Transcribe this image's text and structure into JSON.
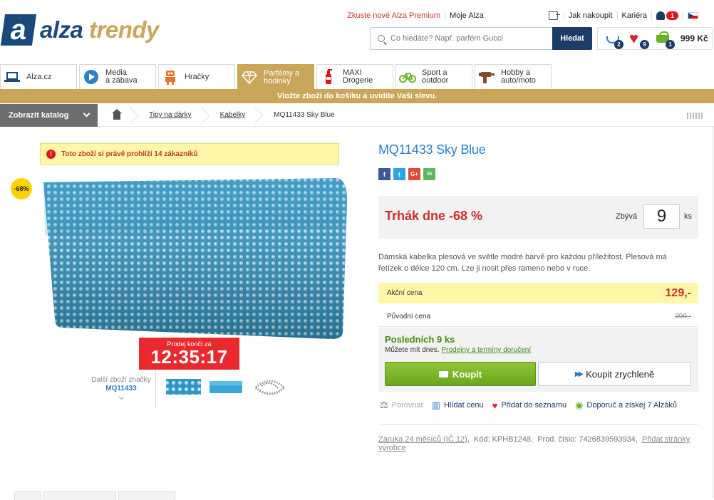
{
  "header": {
    "logo_mark": "a",
    "logo_word1": "alza",
    "logo_word2": "trendy",
    "premium_link": "Zkuste nové Alza Premium",
    "account_link": "Moje Alza",
    "how_to_buy": "Jak nakoupit",
    "career": "Kariéra",
    "notifications_count": "1",
    "search_placeholder": "Co hledáte? Např. parfém Gucci",
    "search_button": "Hledat",
    "compare_count": "2",
    "wishlist_count": "9",
    "cart_count": "1",
    "cart_total": "999 Kč"
  },
  "tabs": [
    {
      "label1": "Alza.cz",
      "label2": "",
      "icon": "laptop-icon"
    },
    {
      "label1": "Media",
      "label2": "a zábava",
      "icon": "play-icon"
    },
    {
      "label1": "Hračky",
      "label2": "",
      "icon": "robot-icon"
    },
    {
      "label1": "Parfémy a",
      "label2": "hodinky",
      "icon": "diamond-icon"
    },
    {
      "label1": "MAXI",
      "label2": "Drogerie",
      "icon": "spray-bottle-icon"
    },
    {
      "label1": "Sport a",
      "label2": "outdoor",
      "icon": "bicycle-icon"
    },
    {
      "label1": "Hobby a",
      "label2": "auto/moto",
      "icon": "drill-icon"
    }
  ],
  "promo_bar": "Vložte zboží do košíku a uvidíte Vaši slevu.",
  "catalog_button": "Zobrazit katalog",
  "breadcrumbs": [
    "Tipy na dárky",
    "Kabelky",
    "MQ11433 Sky Blue"
  ],
  "viewing_alert": "Toto zboží si právě prohlíží 14 zákazníků",
  "discount_badge": "-68%",
  "countdown": {
    "label": "Prodej končí za",
    "time": "12:35:17"
  },
  "brand_more": {
    "label": "Další zboží značky",
    "brand": "MQ11433"
  },
  "product": {
    "title": "MQ11433 Sky Blue",
    "deal_title": "Trhák dne -68 %",
    "remaining_label": "Zbývá",
    "remaining_value": "9",
    "remaining_unit": "ks",
    "description": "Dámská kabelka plesová ve světle modré barvě pro každou příležitost. Plesová má řetízek o délce 120 cm. Lze ji nosit přes rameno nebo v ruce.",
    "action_price_label": "Akční cena",
    "action_price": "129,-",
    "original_price_label": "Původní cena",
    "original_price": "399,-",
    "stock_title": "Posledních 9 ks",
    "stock_sub": "Můžete mít dnes.",
    "stock_link": "Prodejny a termíny doručení",
    "buy_button": "Koupit",
    "buy_fast_button": "Koupit zrychleně",
    "compare": "Porovnat",
    "watch_price": "Hlídat cenu",
    "add_to_list": "Přidat do seznamu",
    "recommend": "Doporuč a získej 7 Alzáků",
    "warranty": "Záruka 24 měsíců (IČ 12)",
    "code": "Kód: KPHB1248,",
    "part_number": "Prod. číslo: 7426839593934,",
    "add_pages": "Přidat stránky výrobce"
  },
  "colors": {
    "brand_blue": "#1a4a7c",
    "gold": "#c9a659",
    "title_blue": "#2a7fc9",
    "deal_red": "#d02d2d",
    "buy_green": "#6aa61b",
    "alert_yellow": "#fdf7a6"
  }
}
